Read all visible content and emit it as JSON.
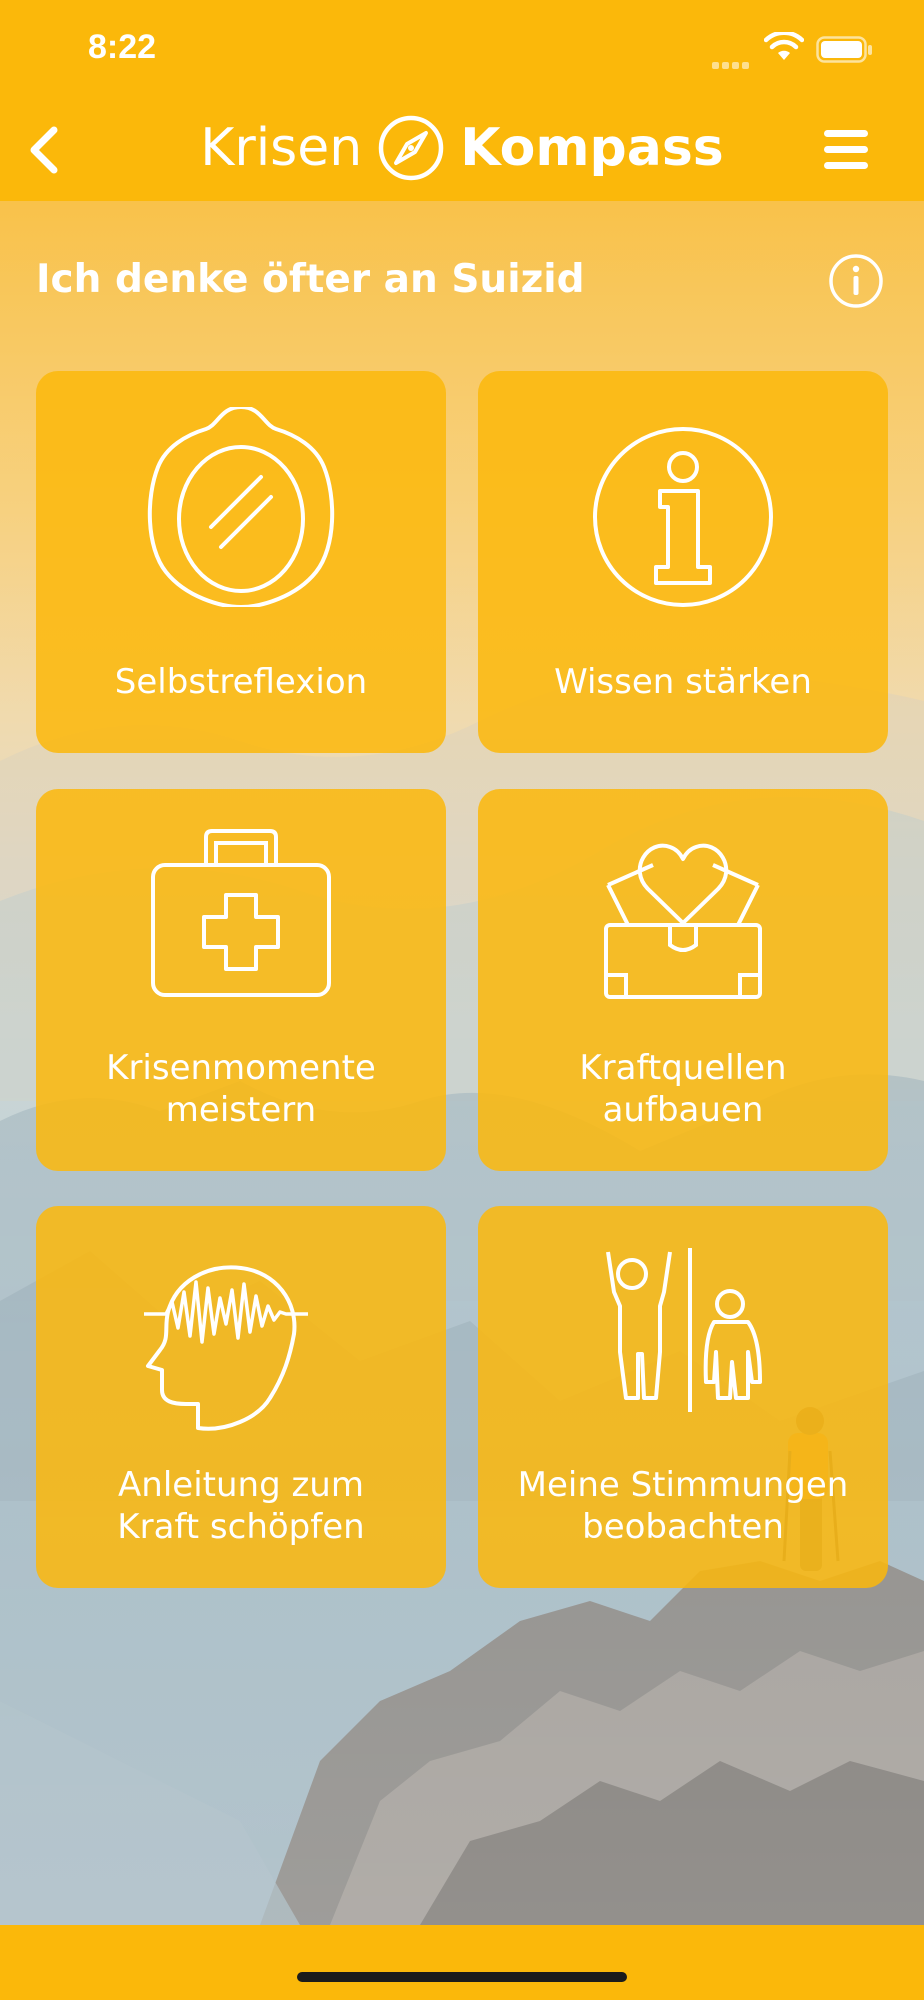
{
  "status_bar": {
    "time": "8:22"
  },
  "nav": {
    "brand_light": "Krisen",
    "brand_bold": "Kompass",
    "back_icon": "chevron-left-icon",
    "menu_icon": "hamburger-menu-icon",
    "logo_icon": "compass-icon"
  },
  "page": {
    "section_title": "Ich denke öfter an Suizid",
    "info_icon": "info-circle-icon"
  },
  "tiles": [
    {
      "label": "Selbstreflexion",
      "icon": "mirror-icon"
    },
    {
      "label": "Wissen stärken",
      "icon": "info-icon"
    },
    {
      "label_line1": "Krisenmomente",
      "label_line2": "meistern",
      "icon": "first-aid-kit-icon"
    },
    {
      "label_line1": "Kraftquellen",
      "label_line2": "aufbauen",
      "icon": "heart-box-icon"
    },
    {
      "label_line1": "Anleitung zum",
      "label_line2": "Kraft schöpfen",
      "icon": "head-waves-icon"
    },
    {
      "label_line1": "Meine Stimmungen",
      "label_line2": "beobachten",
      "icon": "mood-figures-icon"
    }
  ],
  "colors": {
    "brand_yellow": "#fbb80a",
    "tile_yellow": "#fbb80c",
    "text_white": "#ffffff"
  }
}
